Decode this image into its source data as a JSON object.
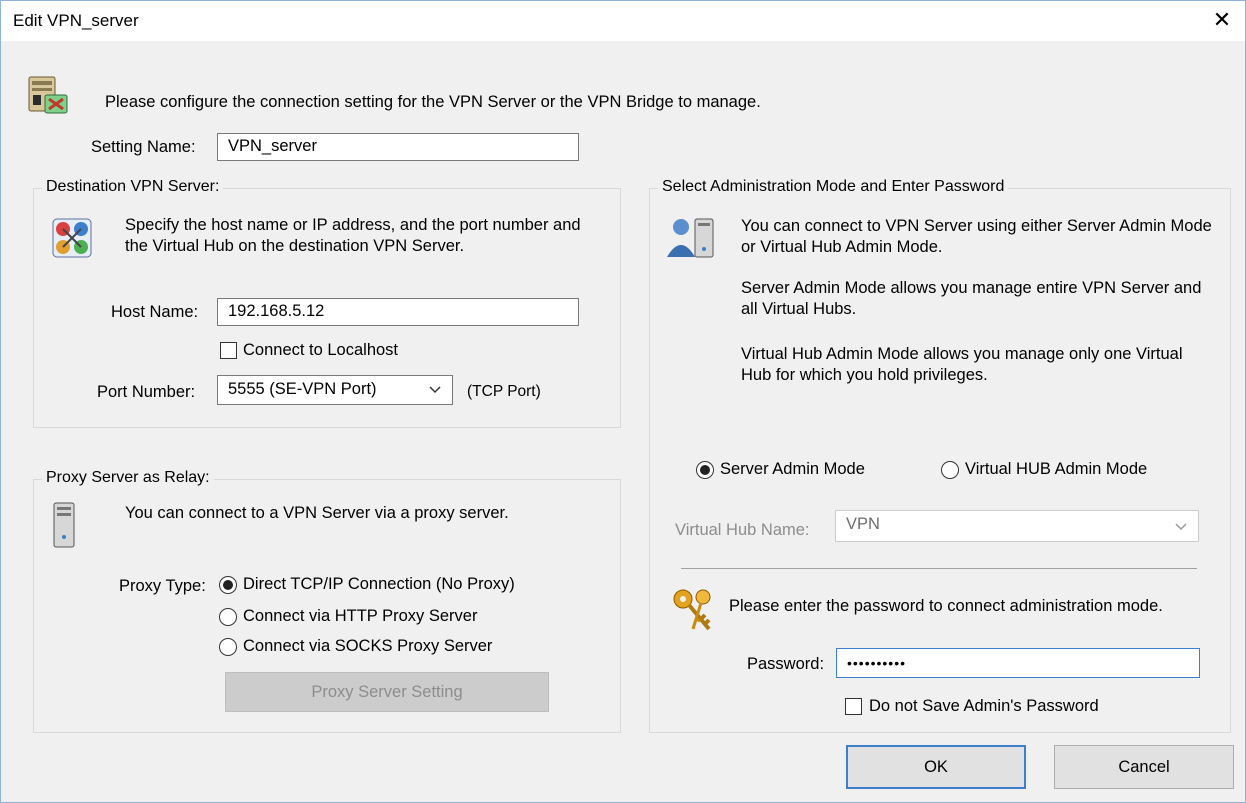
{
  "window": {
    "title": "Edit VPN_server",
    "close_glyph": "✕"
  },
  "intro": {
    "text": "Please configure the connection setting for the VPN Server or the VPN Bridge to manage."
  },
  "setting_name": {
    "label": "Setting Name:",
    "value": "VPN_server"
  },
  "destination": {
    "title": "Destination VPN Server:",
    "description": "Specify the host name or IP address, and the port number and the Virtual Hub on the destination VPN Server.",
    "host_label": "Host Name:",
    "host_value": "192.168.5.12",
    "localhost_label": "Connect to Localhost",
    "localhost_checked": false,
    "port_label": "Port Number:",
    "port_value": "5555 (SE-VPN Port)",
    "port_suffix": "(TCP Port)"
  },
  "proxy": {
    "title": "Proxy Server as Relay:",
    "description": "You can connect to a VPN Server via a proxy server.",
    "type_label": "Proxy Type:",
    "options": [
      {
        "label": "Direct TCP/IP Connection (No Proxy)",
        "selected": true
      },
      {
        "label": "Connect via HTTP Proxy Server",
        "selected": false
      },
      {
        "label": "Connect via SOCKS Proxy Server",
        "selected": false
      }
    ],
    "setting_button": "Proxy Server Setting"
  },
  "admin": {
    "title": "Select Administration Mode and Enter Password",
    "paragraph1": "You can connect to VPN Server using either Server Admin Mode or Virtual Hub Admin Mode.",
    "paragraph2": "Server Admin Mode allows you manage entire VPN Server and all Virtual Hubs.",
    "paragraph3": "Virtual Hub Admin Mode allows you manage only one Virtual Hub for which you hold privileges.",
    "mode_server": "Server Admin Mode",
    "mode_hub": "Virtual HUB Admin Mode",
    "selected_mode": "server",
    "hub_name_label": "Virtual Hub Name:",
    "hub_name_value": "VPN",
    "password_prompt": "Please enter the password to connect administration mode.",
    "password_label": "Password:",
    "password_value": "••••••••••",
    "no_save_label": "Do not Save Admin's Password",
    "no_save_checked": false
  },
  "buttons": {
    "ok": "OK",
    "cancel": "Cancel"
  },
  "colors": {
    "accent": "#3c7fcc",
    "window_border": "#8fb3d9",
    "background": "#f0f0f0"
  },
  "icons": [
    "server-config-icon",
    "network-globe-icon",
    "admin-user-server-icon",
    "tower-pc-icon",
    "keys-icon"
  ]
}
